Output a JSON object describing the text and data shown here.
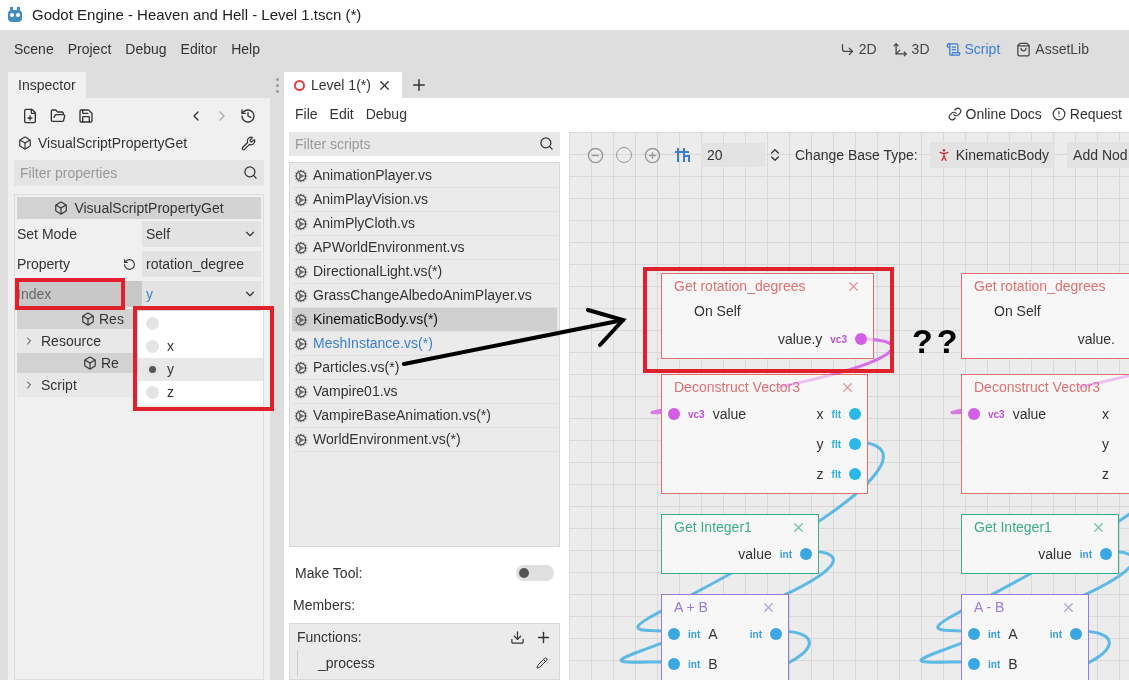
{
  "window": {
    "title": "Godot Engine - Heaven and Hell - Level 1.tscn (*)"
  },
  "menu": [
    "Scene",
    "Project",
    "Debug",
    "Editor",
    "Help"
  ],
  "workspaces": [
    {
      "kind": "twod",
      "label": "2D",
      "selected": false
    },
    {
      "kind": "threed",
      "label": "3D",
      "selected": false
    },
    {
      "kind": "script",
      "label": "Script",
      "selected": true
    },
    {
      "kind": "assetlib",
      "label": "AssetLib",
      "selected": false
    }
  ],
  "inspector": {
    "tab": "Inspector",
    "object": "VisualScriptPropertyGet",
    "filter": {
      "placeholder": "Filter properties"
    },
    "section": "VisualScriptPropertyGet",
    "properties": [
      {
        "kind": "dropdown",
        "label": "Set Mode",
        "value": "Self",
        "highlighted": false
      },
      {
        "kind": "text",
        "label": "Property",
        "value": "rotation_degree",
        "highlighted": false
      },
      {
        "kind": "dropdown",
        "label": "Index",
        "value": "y",
        "highlighted": true
      }
    ],
    "groups": [
      {
        "header": "Res",
        "item": "Resource"
      },
      {
        "header": "Re",
        "item": "Script"
      }
    ],
    "popup": {
      "options": [
        {
          "selected": false
        },
        {
          "label": "x",
          "selected": false
        },
        {
          "label": "y",
          "selected": true
        },
        {
          "label": "z",
          "selected": false
        }
      ]
    }
  },
  "editor_tabs": [
    {
      "label": "Level 1(*)",
      "selected": true
    }
  ],
  "script_menu": [
    "File",
    "Edit",
    "Debug"
  ],
  "links": [
    {
      "kind": "docs",
      "label": "Online Docs"
    },
    {
      "kind": "issue",
      "label": "Request"
    }
  ],
  "scripts": {
    "filter": {
      "placeholder": "Filter scripts"
    },
    "items": [
      {
        "name": "AnimationPlayer.vs",
        "selected": false,
        "highlighted": false
      },
      {
        "name": "AnimPlayVision.vs",
        "selected": false,
        "highlighted": false
      },
      {
        "name": "AnimPlyCloth.vs",
        "selected": false,
        "highlighted": false
      },
      {
        "name": "APWorldEnvironment.vs",
        "selected": false,
        "highlighted": false
      },
      {
        "name": "DirectionalLight.vs(*)",
        "selected": false,
        "highlighted": false
      },
      {
        "name": "GrassChangeAlbedoAnimPlayer.vs",
        "selected": false,
        "highlighted": false
      },
      {
        "name": "KinematicBody.vs(*)",
        "selected": true,
        "highlighted": false
      },
      {
        "name": "MeshInstance.vs(*)",
        "selected": false,
        "highlighted": true
      },
      {
        "name": "Particles.vs(*)",
        "selected": false,
        "highlighted": false
      },
      {
        "name": "Vampire01.vs",
        "selected": false,
        "highlighted": false
      },
      {
        "name": "VampireBaseAnimation.vs(*)",
        "selected": false,
        "highlighted": false
      },
      {
        "name": "WorldEnvironment.vs(*)",
        "selected": false,
        "highlighted": false
      }
    ]
  },
  "make_tool": {
    "label": "Make Tool:",
    "on": false
  },
  "members": {
    "label": "Members:",
    "functions": {
      "label": "Functions:",
      "items": [
        "_process"
      ]
    }
  },
  "graph": {
    "toolbar": {
      "snap": "20",
      "base_type_label": "Change Base Type:",
      "base_type": "KinematicBody",
      "add_node": "Add Nod"
    },
    "columns": [
      {
        "nodes": [
          {
            "title": "Get rotation_degrees",
            "color": "#e07070",
            "closable": true,
            "rows": [
              {
                "kind": "text",
                "label": "On Self"
              },
              {
                "kind": "ports",
                "right": {
                  "label": "value.y",
                  "type": "vc3"
                }
              }
            ]
          },
          {
            "title": "Deconstruct Vector3",
            "color": "#e07070",
            "closable": true,
            "rows": [
              {
                "kind": "ports",
                "left": {
                  "label": "value",
                  "type": "vc3"
                },
                "right": {
                  "label": "x",
                  "type": "flt"
                }
              },
              {
                "kind": "ports",
                "right": {
                  "label": "y",
                  "type": "flt"
                }
              },
              {
                "kind": "ports",
                "right": {
                  "label": "z",
                  "type": "flt"
                }
              }
            ]
          },
          {
            "title": "Get Integer1",
            "color": "#3cae82",
            "closable": true,
            "rows": [
              {
                "kind": "ports",
                "right": {
                  "label": "value",
                  "type": "int"
                }
              }
            ]
          },
          {
            "title": "A + B",
            "color": "#9a7ad8",
            "closable": true,
            "rows": [
              {
                "kind": "ports",
                "left": {
                  "label": "A",
                  "type": "int"
                },
                "right": {
                  "type": "int"
                }
              },
              {
                "kind": "ports",
                "left": {
                  "label": "B",
                  "type": "int"
                }
              }
            ]
          }
        ]
      },
      {
        "nodes": [
          {
            "title": "Get rotation_degrees",
            "color": "#e07070",
            "closable": false,
            "rows": [
              {
                "kind": "text",
                "label": "On Self"
              },
              {
                "kind": "ports",
                "right": {
                  "label": "value."
                }
              }
            ]
          },
          {
            "title": "Deconstruct Vector3",
            "color": "#e07070",
            "closable": false,
            "rows": [
              {
                "kind": "ports",
                "left": {
                  "label": "value",
                  "type": "vc3"
                },
                "right": {
                  "label": "x"
                }
              },
              {
                "kind": "ports",
                "right": {
                  "label": "y"
                }
              },
              {
                "kind": "ports",
                "right": {
                  "label": "z"
                }
              }
            ]
          },
          {
            "title": "Get Integer1",
            "color": "#3cae82",
            "closable": true,
            "rows": [
              {
                "kind": "ports",
                "right": {
                  "label": "value",
                  "type": "int"
                }
              }
            ]
          },
          {
            "title": "A - B",
            "color": "#9a7ad8",
            "closable": true,
            "rows": [
              {
                "kind": "ports",
                "left": {
                  "label": "A",
                  "type": "int"
                },
                "right": {
                  "type": "int"
                }
              },
              {
                "kind": "ports",
                "left": {
                  "label": "B",
                  "type": "int"
                }
              }
            ]
          }
        ]
      }
    ]
  },
  "annotations": {
    "marks": [
      "?",
      "?"
    ]
  }
}
